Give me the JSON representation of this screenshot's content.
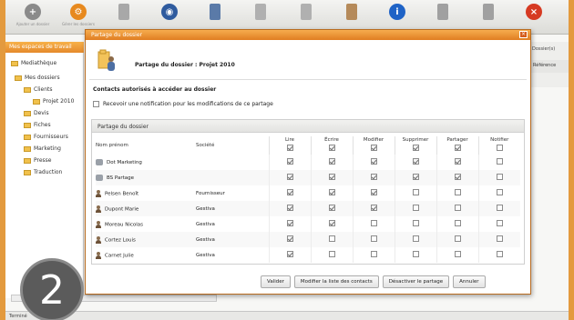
{
  "toolbar": {
    "buttons": [
      {
        "icon": "add-icon",
        "label": "Ajouter un dossier",
        "color": "#8a8a8a"
      },
      {
        "icon": "settings-icon",
        "label": "Gérer les dossiers",
        "color": "#e7891e"
      },
      {
        "icon": "file-icon",
        "label": "",
        "color": "#a8a8a8"
      },
      {
        "icon": "globe-icon",
        "label": "",
        "color": "#2f5b9e"
      },
      {
        "icon": "share-icon",
        "label": "",
        "color": "#5a7aa8"
      },
      {
        "icon": "document-icon",
        "label": "",
        "color": "#b0b0b0"
      },
      {
        "icon": "copy-icon",
        "label": "",
        "color": "#b0b0b0"
      },
      {
        "icon": "user-icon",
        "label": "",
        "color": "#b58a5a"
      },
      {
        "icon": "info-icon",
        "label": "",
        "color": "#1f63c6"
      },
      {
        "icon": "print-icon",
        "label": "",
        "color": "#a0a0a0"
      },
      {
        "icon": "export-icon",
        "label": "",
        "color": "#a0a0a0"
      },
      {
        "icon": "close-icon",
        "label": "",
        "color": "#d63a22"
      }
    ]
  },
  "left_panel": {
    "header": "Mes espaces de travail",
    "title": "Mediathèque",
    "items": [
      {
        "label": "Mes dossiers",
        "indent": 0
      },
      {
        "label": "Clients",
        "indent": 1
      },
      {
        "label": "Projet 2010",
        "indent": 2
      },
      {
        "label": "Devis",
        "indent": 1
      },
      {
        "label": "Fiches",
        "indent": 1
      },
      {
        "label": "Fournisseurs",
        "indent": 1
      },
      {
        "label": "Marketing",
        "indent": 1
      },
      {
        "label": "Presse",
        "indent": 1
      },
      {
        "label": "Traduction",
        "indent": 1
      }
    ]
  },
  "right_strip": {
    "tab": "Dossier(s)",
    "head": "Référence"
  },
  "status": "Terminé",
  "dialog": {
    "title": "Partage du dossier",
    "heading": "Partage du dossier : Projet 2010",
    "contacts_label": "Contacts autorisés à accéder au dossier",
    "notify_label": "Recevoir une notification pour les modifications de ce partage",
    "share_section": "Partage du dossier",
    "columns": [
      "Nom prénom",
      "Société",
      "Lire",
      "Écrire",
      "Modifier",
      "Supprimer",
      "Partager",
      "Notifier"
    ],
    "rows": [
      {
        "type": "group",
        "name": "Dot Marketing",
        "company": "",
        "perms": [
          true,
          true,
          true,
          true,
          true,
          false
        ]
      },
      {
        "type": "group",
        "name": "BS Partage",
        "company": "",
        "perms": [
          true,
          true,
          true,
          true,
          true,
          false
        ]
      },
      {
        "type": "person",
        "name": "Pelsen Benoît",
        "company": "Fournisseur",
        "perms": [
          true,
          true,
          true,
          false,
          false,
          false
        ]
      },
      {
        "type": "person",
        "name": "Dupont Marie",
        "company": "Gestiva",
        "perms": [
          true,
          true,
          true,
          false,
          false,
          false
        ]
      },
      {
        "type": "person",
        "name": "Moreau Nicolas",
        "company": "Gestiva",
        "perms": [
          true,
          true,
          false,
          false,
          false,
          false
        ]
      },
      {
        "type": "person",
        "name": "Cortez Louis",
        "company": "Gestiva",
        "perms": [
          true,
          false,
          false,
          false,
          false,
          false
        ]
      },
      {
        "type": "person",
        "name": "Carnet Julie",
        "company": "Gestiva",
        "perms": [
          true,
          false,
          false,
          false,
          false,
          false
        ]
      }
    ],
    "header_checks": [
      true,
      true,
      true,
      true,
      true,
      false
    ],
    "buttons": [
      "Valider",
      "Modifier la liste des contacts",
      "Désactiver le partage",
      "Annuler"
    ]
  },
  "badge": "2"
}
